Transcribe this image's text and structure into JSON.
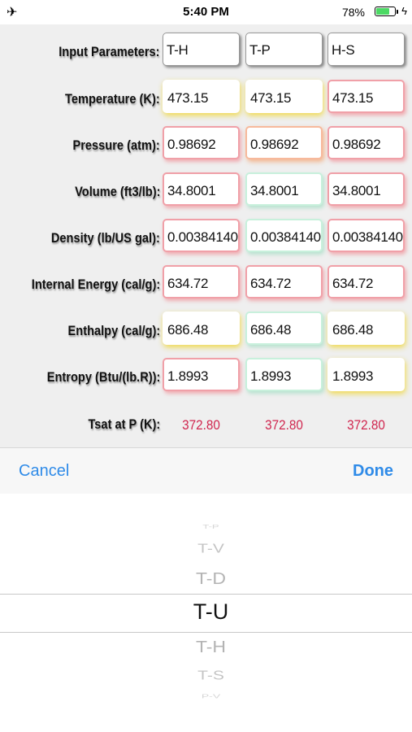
{
  "status_bar": {
    "time": "5:40 PM",
    "battery_percent": "78%",
    "battery_level": 0.78,
    "mode_icon": "airplane-icon",
    "charging_icon": "bolt-icon"
  },
  "form": {
    "input_label": "Input Parameters:",
    "input_buttons": [
      "T-H",
      "T-P",
      "H-S"
    ],
    "rows": [
      {
        "label": "Temperature (K):",
        "values": [
          "473.15",
          "473.15",
          "473.15"
        ]
      },
      {
        "label": "Pressure (atm):",
        "values": [
          "0.98692",
          "0.98692",
          "0.98692"
        ]
      },
      {
        "label": "Volume (ft3/lb):",
        "values": [
          "34.8001",
          "34.8001",
          "34.8001"
        ]
      },
      {
        "label": "Density (lb/US gal):",
        "values": [
          "0.00384140",
          "0.00384140",
          "0.00384140"
        ]
      },
      {
        "label": "Internal Energy (cal/g):",
        "values": [
          "634.72",
          "634.72",
          "634.72"
        ]
      },
      {
        "label": "Enthalpy (cal/g):",
        "values": [
          "686.48",
          "686.48",
          "686.48"
        ]
      },
      {
        "label": "Entropy (Btu/(lb.R)):",
        "values": [
          "1.8993",
          "1.8993",
          "1.8993"
        ]
      }
    ],
    "tsat": {
      "label": "Tsat at P (K):",
      "values": [
        "372.80",
        "372.80",
        "372.80"
      ]
    }
  },
  "toolbar": {
    "cancel": "Cancel",
    "done": "Done"
  },
  "picker": {
    "options": [
      "T-P",
      "T-V",
      "T-D",
      "T-U",
      "T-H",
      "T-S",
      "P-V"
    ],
    "selected": "T-U"
  },
  "colors": {
    "accent": "#2f8be8",
    "tsat": "#d0264f",
    "battery": "#4cd964"
  }
}
